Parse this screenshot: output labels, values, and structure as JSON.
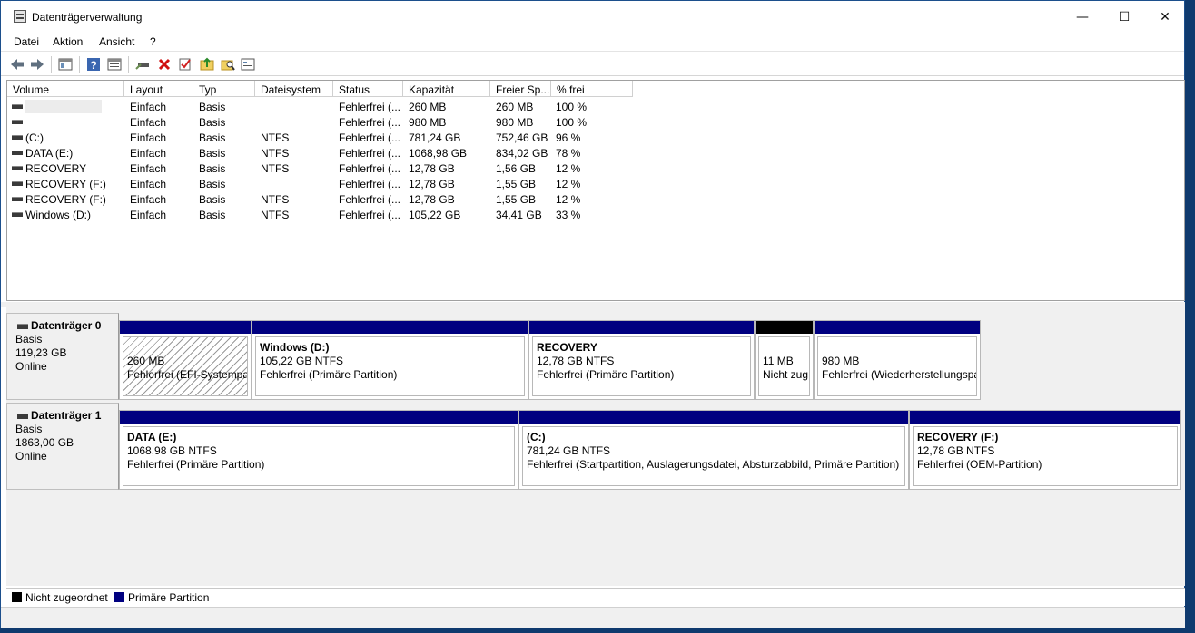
{
  "window": {
    "title": "Datenträgerverwaltung",
    "controls": {
      "minimize": "—",
      "maximize": "☐",
      "close": "✕"
    }
  },
  "menu": [
    "Datei",
    "Aktion",
    "Ansicht",
    "?"
  ],
  "toolbar_icons": [
    "back-arrow-icon",
    "forward-arrow-icon",
    "console-tree-icon",
    "help-icon",
    "properties-icon",
    "connect-drive-icon",
    "delete-icon",
    "check-icon",
    "folder-up-icon",
    "folder-search-icon",
    "view-settings-icon"
  ],
  "volume_table": {
    "columns": [
      "Volume",
      "Layout",
      "Typ",
      "Dateisystem",
      "Status",
      "Kapazität",
      "Freier Sp...",
      "% frei"
    ],
    "rows": [
      [
        "",
        "Einfach",
        "Basis",
        "",
        "Fehlerfrei (...",
        "260 MB",
        "260 MB",
        "100 %"
      ],
      [
        "",
        "Einfach",
        "Basis",
        "",
        "Fehlerfrei (...",
        "980 MB",
        "980 MB",
        "100 %"
      ],
      [
        "(C:)",
        "Einfach",
        "Basis",
        "NTFS",
        "Fehlerfrei (...",
        "781,24 GB",
        "752,46 GB",
        "96 %"
      ],
      [
        "DATA (E:)",
        "Einfach",
        "Basis",
        "NTFS",
        "Fehlerfrei (...",
        "1068,98 GB",
        "834,02 GB",
        "78 %"
      ],
      [
        "RECOVERY",
        "Einfach",
        "Basis",
        "NTFS",
        "Fehlerfrei (...",
        "12,78 GB",
        "1,56 GB",
        "12 %"
      ],
      [
        "RECOVERY (F:)",
        "Einfach",
        "Basis",
        "",
        "Fehlerfrei (...",
        "12,78 GB",
        "1,55 GB",
        "12 %"
      ],
      [
        "RECOVERY (F:)",
        "Einfach",
        "Basis",
        "NTFS",
        "Fehlerfrei (...",
        "12,78 GB",
        "1,55 GB",
        "12 %"
      ],
      [
        "Windows (D:)",
        "Einfach",
        "Basis",
        "NTFS",
        "Fehlerfrei (...",
        "105,22 GB",
        "34,41 GB",
        "33 %"
      ]
    ]
  },
  "disks": [
    {
      "name": "Datenträger 0",
      "type": "Basis",
      "size": "119,23 GB",
      "status": "Online",
      "partitions": [
        {
          "name": "",
          "size": "260 MB",
          "status": "Fehlerfrei (EFI-Systempar",
          "kind": "primary",
          "hatched": true
        },
        {
          "name": "Windows  (D:)",
          "size": "105,22 GB NTFS",
          "status": "Fehlerfrei (Primäre Partition)",
          "kind": "primary",
          "hatched": false
        },
        {
          "name": "RECOVERY",
          "size": "12,78 GB NTFS",
          "status": "Fehlerfrei (Primäre Partition)",
          "kind": "primary",
          "hatched": false
        },
        {
          "name": "",
          "size": "11 MB",
          "status": "Nicht zug",
          "kind": "unallocated",
          "hatched": false
        },
        {
          "name": "",
          "size": "980 MB",
          "status": "Fehlerfrei (Wiederherstellungspa",
          "kind": "primary",
          "hatched": false
        }
      ]
    },
    {
      "name": "Datenträger 1",
      "type": "Basis",
      "size": "1863,00 GB",
      "status": "Online",
      "partitions": [
        {
          "name": "DATA  (E:)",
          "size": "1068,98 GB NTFS",
          "status": "Fehlerfrei (Primäre Partition)",
          "kind": "primary",
          "hatched": false
        },
        {
          "name": "(C:)",
          "size": "781,24 GB NTFS",
          "status": "Fehlerfrei (Startpartition, Auslagerungsdatei, Absturzabbild, Primäre Partition)",
          "kind": "primary",
          "hatched": false
        },
        {
          "name": "RECOVERY  (F:)",
          "size": "12,78 GB NTFS",
          "status": "Fehlerfrei (OEM-Partition)",
          "kind": "primary",
          "hatched": false
        }
      ]
    }
  ],
  "legend": [
    {
      "label": "Nicht zugeordnet",
      "color": "#000000"
    },
    {
      "label": "Primäre Partition",
      "color": "#000080"
    }
  ],
  "colors": {
    "primary": "#000080",
    "unallocated": "#000000"
  }
}
